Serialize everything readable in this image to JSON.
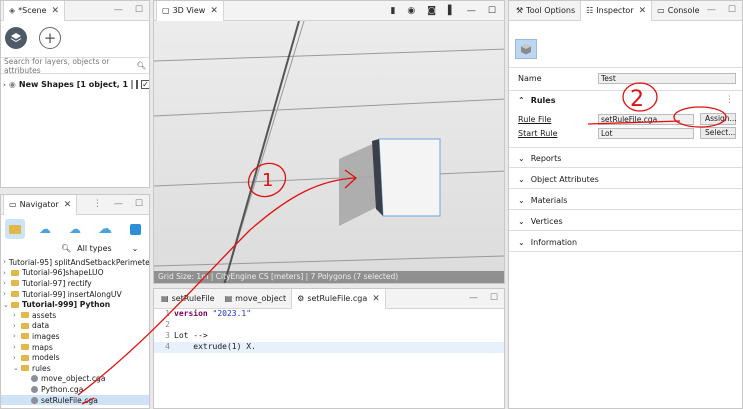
{
  "scene": {
    "tab_label": "*Scene",
    "search_placeholder": "Search for layers, objects or attributes",
    "layer_row": "New Shapes [1 object, 1"
  },
  "navigator": {
    "tab_label": "Navigator",
    "filter": "All types",
    "tree": [
      {
        "label": "Tutorial-95] splitAndSetbackPerimete",
        "kind": "project",
        "depth": 0,
        "open": false
      },
      {
        "label": "Tutorial-96]shapeLUO",
        "kind": "project",
        "depth": 0,
        "open": false
      },
      {
        "label": "Tutorial-97] rectify",
        "kind": "project",
        "depth": 0,
        "open": false
      },
      {
        "label": "Tutorial-99] insertAlongUV",
        "kind": "project",
        "depth": 0,
        "open": false
      },
      {
        "label": "Tutorial-999] Python",
        "kind": "project",
        "depth": 0,
        "open": true,
        "bold": true
      },
      {
        "label": "assets",
        "kind": "folder",
        "depth": 1
      },
      {
        "label": "data",
        "kind": "folder",
        "depth": 1
      },
      {
        "label": "images",
        "kind": "folder",
        "depth": 1
      },
      {
        "label": "maps",
        "kind": "folder",
        "depth": 1
      },
      {
        "label": "models",
        "kind": "folder",
        "depth": 1,
        "open": false
      },
      {
        "label": "rules",
        "kind": "folder",
        "depth": 1,
        "open": true
      },
      {
        "label": "move_object.cga",
        "kind": "file",
        "depth": 2
      },
      {
        "label": "Python.cga",
        "kind": "file",
        "depth": 2
      },
      {
        "label": "setRuleFile.cga",
        "kind": "file",
        "depth": 2,
        "selected": true
      }
    ]
  },
  "view3d": {
    "tab_label": "3D View",
    "status": "Grid Size: 1m  |  CityEngine CS [meters]  |  7 Polygons  (7 selected)"
  },
  "editor": {
    "tabs": [
      "setRuleFile",
      "move_object",
      "setRuleFile.cga"
    ],
    "lines": [
      {
        "n": "1",
        "kw": "version",
        "rest": " \"2023.1\""
      },
      {
        "n": "2",
        "kw": "",
        "rest": ""
      },
      {
        "n": "3",
        "kw": "",
        "rest": "Lot -->"
      },
      {
        "n": "4",
        "kw": "",
        "rest": "    extrude(1) X."
      }
    ]
  },
  "inspector": {
    "tabs": [
      "Tool Options",
      "Inspector",
      "Console"
    ],
    "name_label": "Name",
    "name_value": "Test",
    "rules_header": "Rules",
    "rule_file_label": "Rule File",
    "rule_file_value": "setRuleFile.cga",
    "assign_label": "Assign...",
    "start_rule_label": "Start Rule",
    "start_rule_value": "Lot",
    "select_label": "Select...",
    "sections": [
      "Reports",
      "Object Attributes",
      "Materials",
      "Vertices",
      "Information"
    ]
  },
  "annotations": {
    "one": "1",
    "two": "2"
  },
  "colors": {
    "annotation": "#e01010",
    "selection": "#cfe3f7"
  }
}
